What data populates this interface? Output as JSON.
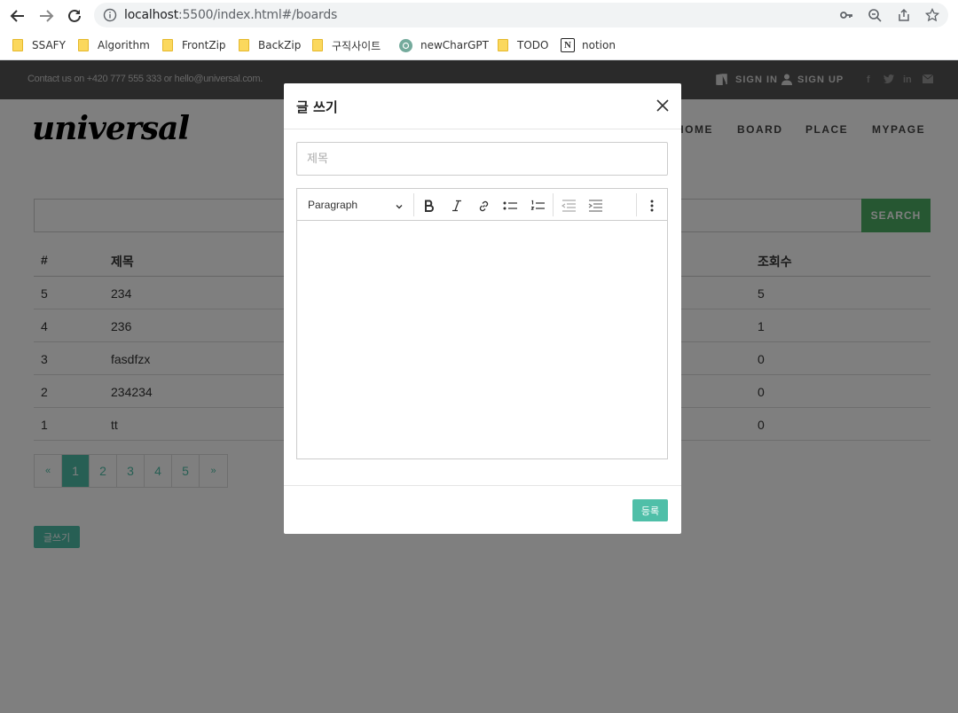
{
  "browser": {
    "url_host": "localhost",
    "url_rest": ":5500/index.html#/boards",
    "bookmarks": [
      {
        "label": "SSAFY",
        "icon": "folder"
      },
      {
        "label": "Algorithm",
        "icon": "folder"
      },
      {
        "label": "FrontZip",
        "icon": "folder"
      },
      {
        "label": "BackZip",
        "icon": "folder"
      },
      {
        "label": "구직사이트",
        "icon": "folder"
      },
      {
        "label": "newCharGPT",
        "icon": "chatgpt"
      },
      {
        "label": "TODO",
        "icon": "folder"
      },
      {
        "label": "notion",
        "icon": "notion"
      }
    ]
  },
  "topbar": {
    "contact": "Contact us on +420 777 555 333 or hello@universal.com.",
    "sign_in": "SIGN IN",
    "sign_up": "SIGN UP"
  },
  "header": {
    "logo": "universal",
    "menu": [
      "HOME",
      "BOARD",
      "PLACE",
      "MYPAGE"
    ]
  },
  "search": {
    "button": "SEARCH"
  },
  "table": {
    "headers": [
      "#",
      "제목",
      "조회수"
    ],
    "rows": [
      {
        "no": "5",
        "title": "234",
        "views": "5"
      },
      {
        "no": "4",
        "title": "236",
        "views": "1"
      },
      {
        "no": "3",
        "title": "fasdfzx",
        "views": "0"
      },
      {
        "no": "2",
        "title": "234234",
        "views": "0"
      },
      {
        "no": "1",
        "title": "tt",
        "views": "0"
      }
    ]
  },
  "pagination": {
    "prev": "«",
    "pages": [
      "1",
      "2",
      "3",
      "4",
      "5"
    ],
    "next": "»",
    "active": "1"
  },
  "write_button": "글쓰기",
  "modal": {
    "title": "글 쓰기",
    "title_placeholder": "제목",
    "toolbar_heading": "Paragraph",
    "submit": "등록"
  }
}
